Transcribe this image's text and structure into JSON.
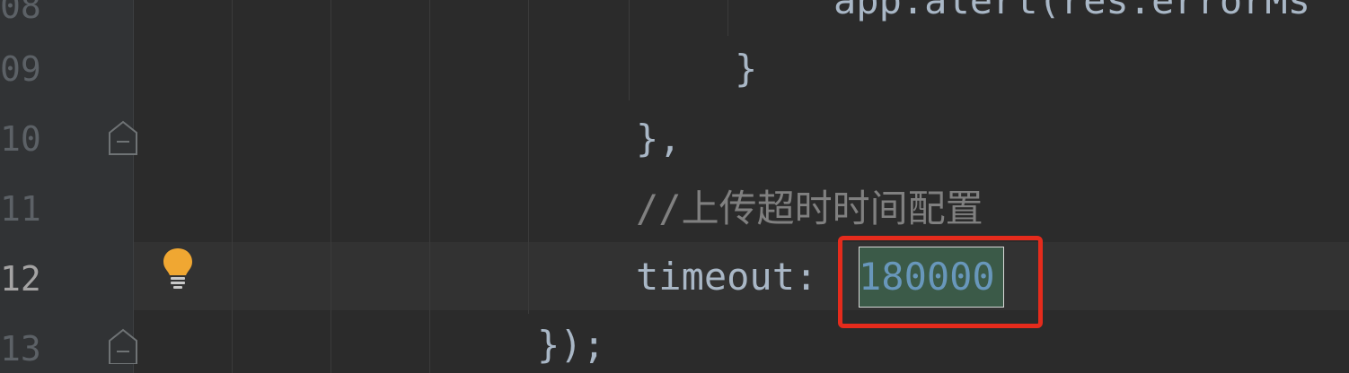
{
  "gutter": {
    "line_numbers": [
      "08",
      "09",
      "10",
      "11",
      "12",
      "13"
    ]
  },
  "code": {
    "line_08": "app.alert(res.errorMs",
    "line_09": "}",
    "line_10": "},",
    "line_11_comment": "//上传超时时间配置",
    "line_12_key": "timeout: ",
    "line_12_value": "180000",
    "line_13": "});"
  },
  "icons": {
    "intention_bulb": "lightbulb-icon",
    "fold": "fold-marker-icon"
  },
  "colors": {
    "background": "#2b2b2b",
    "gutter": "#313335",
    "text": "#a9b7c6",
    "comment": "#808080",
    "number": "#6897bb",
    "selection": "#3b5a48",
    "annotation_box": "#e52b1c",
    "bulb": "#f0a732"
  }
}
